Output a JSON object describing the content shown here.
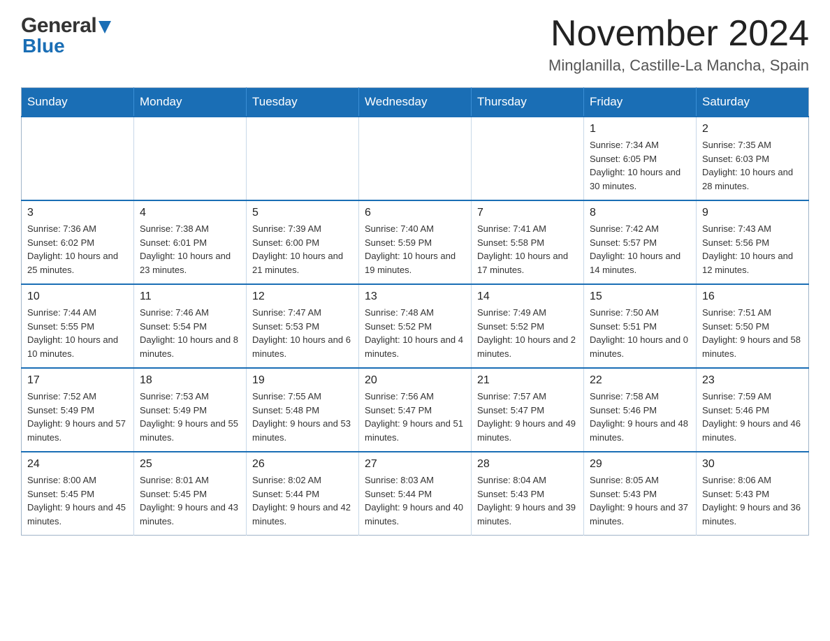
{
  "logo": {
    "general": "General",
    "blue": "Blue"
  },
  "header": {
    "title": "November 2024",
    "subtitle": "Minglanilla, Castille-La Mancha, Spain"
  },
  "calendar": {
    "weekdays": [
      "Sunday",
      "Monday",
      "Tuesday",
      "Wednesday",
      "Thursday",
      "Friday",
      "Saturday"
    ],
    "rows": [
      [
        {
          "day": "",
          "info": ""
        },
        {
          "day": "",
          "info": ""
        },
        {
          "day": "",
          "info": ""
        },
        {
          "day": "",
          "info": ""
        },
        {
          "day": "",
          "info": ""
        },
        {
          "day": "1",
          "info": "Sunrise: 7:34 AM\nSunset: 6:05 PM\nDaylight: 10 hours and 30 minutes."
        },
        {
          "day": "2",
          "info": "Sunrise: 7:35 AM\nSunset: 6:03 PM\nDaylight: 10 hours and 28 minutes."
        }
      ],
      [
        {
          "day": "3",
          "info": "Sunrise: 7:36 AM\nSunset: 6:02 PM\nDaylight: 10 hours and 25 minutes."
        },
        {
          "day": "4",
          "info": "Sunrise: 7:38 AM\nSunset: 6:01 PM\nDaylight: 10 hours and 23 minutes."
        },
        {
          "day": "5",
          "info": "Sunrise: 7:39 AM\nSunset: 6:00 PM\nDaylight: 10 hours and 21 minutes."
        },
        {
          "day": "6",
          "info": "Sunrise: 7:40 AM\nSunset: 5:59 PM\nDaylight: 10 hours and 19 minutes."
        },
        {
          "day": "7",
          "info": "Sunrise: 7:41 AM\nSunset: 5:58 PM\nDaylight: 10 hours and 17 minutes."
        },
        {
          "day": "8",
          "info": "Sunrise: 7:42 AM\nSunset: 5:57 PM\nDaylight: 10 hours and 14 minutes."
        },
        {
          "day": "9",
          "info": "Sunrise: 7:43 AM\nSunset: 5:56 PM\nDaylight: 10 hours and 12 minutes."
        }
      ],
      [
        {
          "day": "10",
          "info": "Sunrise: 7:44 AM\nSunset: 5:55 PM\nDaylight: 10 hours and 10 minutes."
        },
        {
          "day": "11",
          "info": "Sunrise: 7:46 AM\nSunset: 5:54 PM\nDaylight: 10 hours and 8 minutes."
        },
        {
          "day": "12",
          "info": "Sunrise: 7:47 AM\nSunset: 5:53 PM\nDaylight: 10 hours and 6 minutes."
        },
        {
          "day": "13",
          "info": "Sunrise: 7:48 AM\nSunset: 5:52 PM\nDaylight: 10 hours and 4 minutes."
        },
        {
          "day": "14",
          "info": "Sunrise: 7:49 AM\nSunset: 5:52 PM\nDaylight: 10 hours and 2 minutes."
        },
        {
          "day": "15",
          "info": "Sunrise: 7:50 AM\nSunset: 5:51 PM\nDaylight: 10 hours and 0 minutes."
        },
        {
          "day": "16",
          "info": "Sunrise: 7:51 AM\nSunset: 5:50 PM\nDaylight: 9 hours and 58 minutes."
        }
      ],
      [
        {
          "day": "17",
          "info": "Sunrise: 7:52 AM\nSunset: 5:49 PM\nDaylight: 9 hours and 57 minutes."
        },
        {
          "day": "18",
          "info": "Sunrise: 7:53 AM\nSunset: 5:49 PM\nDaylight: 9 hours and 55 minutes."
        },
        {
          "day": "19",
          "info": "Sunrise: 7:55 AM\nSunset: 5:48 PM\nDaylight: 9 hours and 53 minutes."
        },
        {
          "day": "20",
          "info": "Sunrise: 7:56 AM\nSunset: 5:47 PM\nDaylight: 9 hours and 51 minutes."
        },
        {
          "day": "21",
          "info": "Sunrise: 7:57 AM\nSunset: 5:47 PM\nDaylight: 9 hours and 49 minutes."
        },
        {
          "day": "22",
          "info": "Sunrise: 7:58 AM\nSunset: 5:46 PM\nDaylight: 9 hours and 48 minutes."
        },
        {
          "day": "23",
          "info": "Sunrise: 7:59 AM\nSunset: 5:46 PM\nDaylight: 9 hours and 46 minutes."
        }
      ],
      [
        {
          "day": "24",
          "info": "Sunrise: 8:00 AM\nSunset: 5:45 PM\nDaylight: 9 hours and 45 minutes."
        },
        {
          "day": "25",
          "info": "Sunrise: 8:01 AM\nSunset: 5:45 PM\nDaylight: 9 hours and 43 minutes."
        },
        {
          "day": "26",
          "info": "Sunrise: 8:02 AM\nSunset: 5:44 PM\nDaylight: 9 hours and 42 minutes."
        },
        {
          "day": "27",
          "info": "Sunrise: 8:03 AM\nSunset: 5:44 PM\nDaylight: 9 hours and 40 minutes."
        },
        {
          "day": "28",
          "info": "Sunrise: 8:04 AM\nSunset: 5:43 PM\nDaylight: 9 hours and 39 minutes."
        },
        {
          "day": "29",
          "info": "Sunrise: 8:05 AM\nSunset: 5:43 PM\nDaylight: 9 hours and 37 minutes."
        },
        {
          "day": "30",
          "info": "Sunrise: 8:06 AM\nSunset: 5:43 PM\nDaylight: 9 hours and 36 minutes."
        }
      ]
    ]
  }
}
